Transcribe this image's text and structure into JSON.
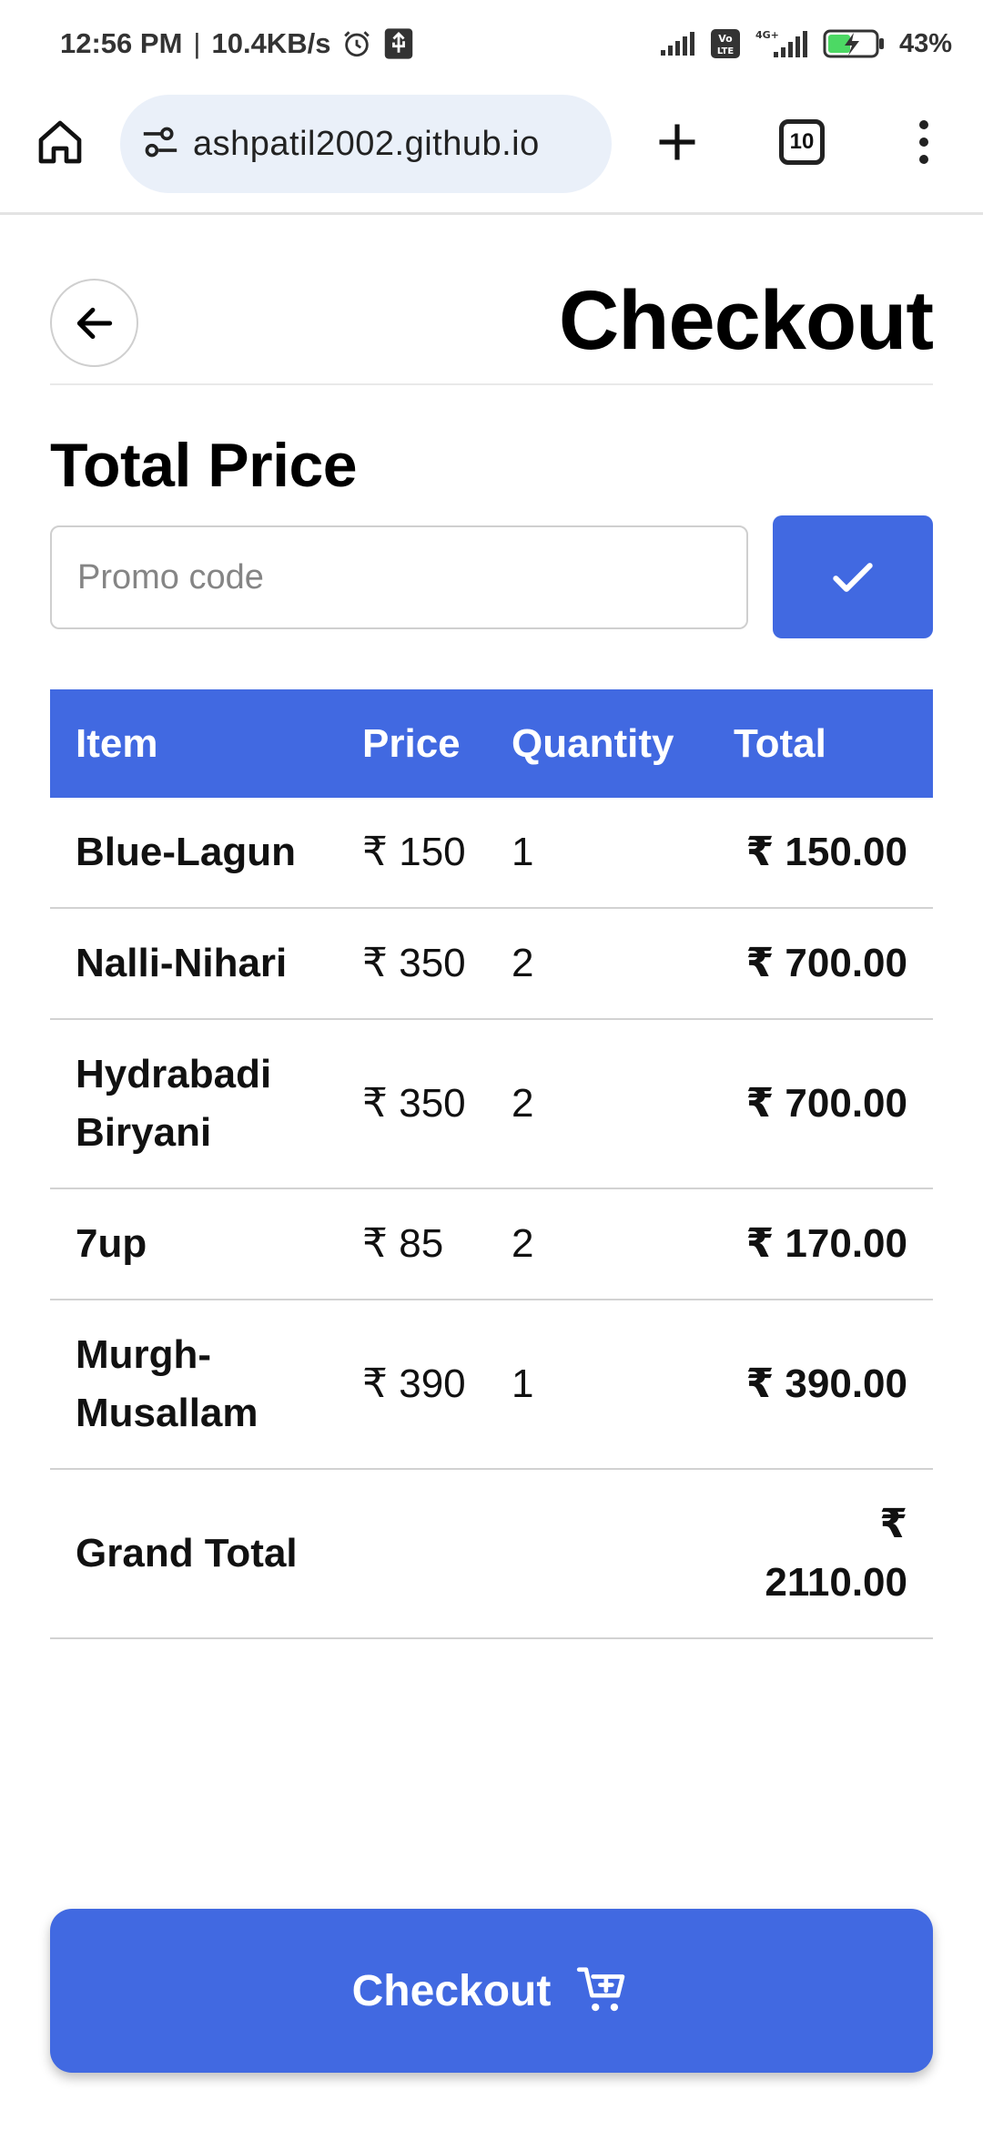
{
  "status_bar": {
    "time": "12:56 PM",
    "separator": "|",
    "network_speed": "10.4KB/s",
    "battery": "43%",
    "icons": [
      "alarm-icon",
      "usb-icon",
      "signal-icon",
      "volte-icon",
      "signal-4g-icon",
      "battery-charging-icon"
    ]
  },
  "browser": {
    "url": "ashpatil2002.github.io",
    "tab_count": "10",
    "icons": [
      "home-icon",
      "site-settings-icon",
      "plus-icon",
      "tabs-icon",
      "more-vert-icon"
    ]
  },
  "header": {
    "title": "Checkout",
    "back_icon": "arrow-left-icon"
  },
  "section_title": "Total Price",
  "promo": {
    "placeholder": "Promo code",
    "value": "",
    "apply_icon": "check-icon"
  },
  "table": {
    "columns": [
      "Item",
      "Price",
      "Quantity",
      "Total"
    ],
    "rows": [
      {
        "item": "Blue-Lagun",
        "price": "₹ 150",
        "qty": "1",
        "total": "₹ 150.00"
      },
      {
        "item": "Nalli-Nihari",
        "price": "₹ 350",
        "qty": "2",
        "total": "₹ 700.00"
      },
      {
        "item": "Hydrabadi Biryani",
        "price": "₹ 350",
        "qty": "2",
        "total": "₹ 700.00"
      },
      {
        "item": "7up",
        "price": "₹ 85",
        "qty": "2",
        "total": "₹ 170.00"
      },
      {
        "item": "Murgh-Musallam",
        "price": "₹ 390",
        "qty": "1",
        "total": "₹ 390.00"
      }
    ],
    "grand_total_label": "Grand Total",
    "grand_total_value": "₹ 2110.00"
  },
  "checkout_button": {
    "label": "Checkout",
    "icon": "cart-add-icon"
  },
  "colors": {
    "accent": "#4169e1",
    "url_bar_bg": "#eaf0f9",
    "divider": "#d2d2d2"
  }
}
